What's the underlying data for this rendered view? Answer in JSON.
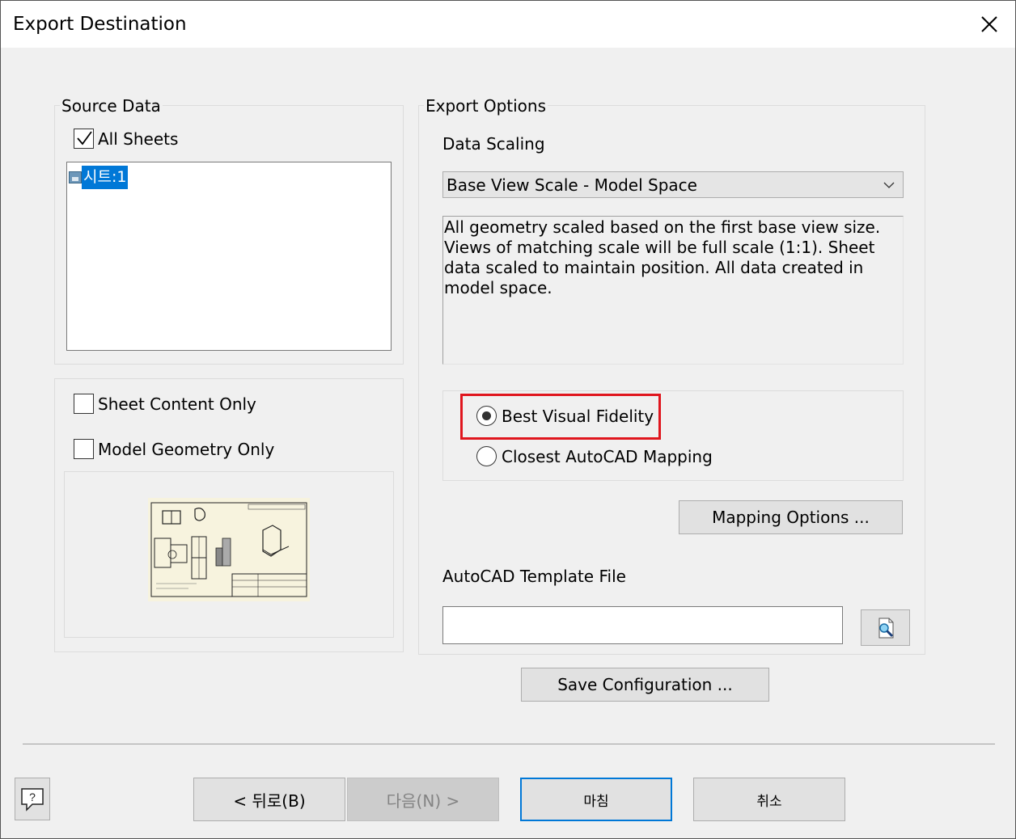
{
  "window": {
    "title": "Export Destination"
  },
  "source_data": {
    "legend": "Source Data",
    "all_sheets_label": "All Sheets",
    "all_sheets_checked": true,
    "sheets": [
      "시트:1"
    ]
  },
  "options_left": {
    "sheet_content_only_label": "Sheet Content Only",
    "sheet_content_only_checked": false,
    "model_geometry_only_label": "Model Geometry Only",
    "model_geometry_only_checked": false
  },
  "export_options": {
    "legend": "Export Options",
    "data_scaling_label": "Data Scaling",
    "data_scaling_value": "Base View Scale - Model Space",
    "description": "All geometry scaled based on the first base view size. Views of matching scale will be full scale (1:1). Sheet data scaled to maintain position. All data created in model space.",
    "radio_options": [
      {
        "label": "Best Visual Fidelity",
        "selected": true
      },
      {
        "label": "Closest AutoCAD Mapping",
        "selected": false
      }
    ],
    "mapping_options_label": "Mapping Options ...",
    "template_file_label": "AutoCAD Template File",
    "template_file_value": ""
  },
  "save_configuration_label": "Save Configuration ...",
  "footer": {
    "back_label": "< 뒤로(B)",
    "next_label": "다음(N) >",
    "finish_label": "마침",
    "cancel_label": "취소"
  },
  "colors": {
    "accent": "#0078d7",
    "highlight_border": "#e0161e",
    "background": "#f0f0f0"
  }
}
